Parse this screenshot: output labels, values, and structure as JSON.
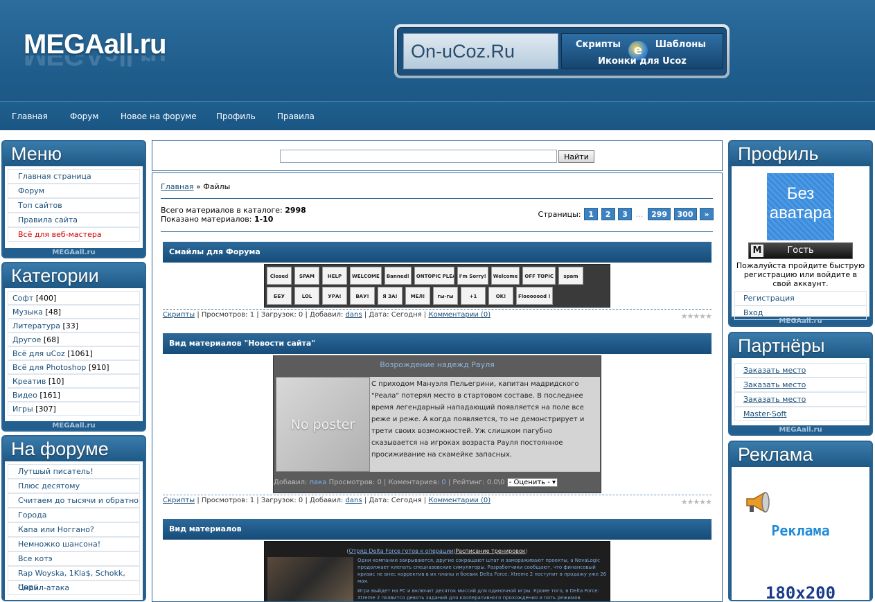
{
  "header": {
    "logo": "MEGAall.ru",
    "banner": {
      "brand": "On-uCoz.Ru",
      "link1": "Скрипты",
      "link2": "Шаблоны",
      "link3": "Иконки для Ucoz"
    }
  },
  "nav": [
    "Главная",
    "Форум",
    "Новое на форуме",
    "Профиль",
    "Правила"
  ],
  "menu": {
    "title": "Меню",
    "items": [
      "Главная страница",
      "Форум",
      "Топ сайтов",
      "Правила сайта",
      "Всё для веб-мастера"
    ],
    "footer": "MEGAall.ru"
  },
  "categories": {
    "title": "Категории",
    "items": [
      {
        "name": "Софт",
        "count": "[400]"
      },
      {
        "name": "Музыка",
        "count": "[48]"
      },
      {
        "name": "Литература",
        "count": "[33]"
      },
      {
        "name": "Другое",
        "count": "[68]"
      },
      {
        "name": "Всё для uCoz",
        "count": "[1061]"
      },
      {
        "name": "Всё для Photoshop",
        "count": "[910]"
      },
      {
        "name": "Креатив",
        "count": "[10]"
      },
      {
        "name": "Видео",
        "count": "[161]"
      },
      {
        "name": "Игры",
        "count": "[307]"
      }
    ],
    "footer": "MEGAall.ru"
  },
  "forum": {
    "title": "На форуме",
    "items": [
      "Лутшый писатель!",
      "Плюс десятому",
      "Считаем до тысячи и обратно",
      "Города",
      "Капа или Ноггано?",
      "Немножко шансона!",
      "Все котэ",
      "Rap Woyska, 1Kla$, Schokk, Царь.",
      "Смайл-атака"
    ]
  },
  "search": {
    "button": "Найти"
  },
  "content": {
    "breadcrumb_home": "Главная",
    "breadcrumb_sep": " » ",
    "breadcrumb_current": "Файлы",
    "total_label": "Всего материалов в каталоге: ",
    "total_value": "2998",
    "shown_label": "Показано материалов: ",
    "shown_value": "1-10",
    "pages_label": "Страницы:",
    "pages": [
      "1",
      "2",
      "3",
      "…",
      "299",
      "300",
      "»"
    ],
    "entries": [
      {
        "title": "Смайлы для Форума",
        "category": "Скрипты",
        "views": " | Просмотров: 1 | Загрузок: 0 | Добавил: ",
        "author": "dans",
        "date": " | Дата: Сегодня | ",
        "comments": "Комментарии (0)"
      },
      {
        "title": "Вид материалов \"Новости сайта\"",
        "category": "Скрипты",
        "views": " | Просмотров: 1 | Загрузок: 0 | Добавил: ",
        "author": "dans",
        "date": " | Дата: Сегодня | ",
        "comments": "Комментарии (0)"
      },
      {
        "title": "Вид материалов"
      }
    ],
    "news_preview": {
      "heading": "Возрождение надежд Рауля",
      "poster": "No poster",
      "text": "С приходом Мануэля Пельегрини, капитан мадридского \"Реала\" потерял место в стартовом составе. В последнее время легендарный нападающий появляется на поле все реже и реже. А когда появляется, то не демонстрирует и трети своих возможностей. Уж слишком пагубно сказывается на игроках возраста Рауля постоянное просиживание на скамейке запасных.",
      "footer_added": "Добавил: ",
      "footer_author": "пака",
      "footer_rest": " Просмотров: 0 | Коментариев: ",
      "footer_comments": "0",
      "footer_rating": " | Рейтинг: 0.0\\0",
      "rate_option": "- Оценить -"
    },
    "game_preview": {
      "link1": "Отряд Delta Force готов к операции",
      "link2": "Расписание тренировок",
      "text1": "Одни компании закрываются, другие сокращают штат и замораживают проекты, а NovaLogic продолжает клепать спецназовские симуляторы. Разработчики сообщают, что финансовый кризис не внес корректив в их планы и боевик Delta Force: Xtreme 2 поступит в продажу уже 26 мая.",
      "text2": "Игра выйдет на PC и включит десяток миссий для одиночной игры. Кроме того, в Delta Force: Xtreme 2 появится девять заданий для кооперативного прохождения и пять режимов"
    },
    "smileys": [
      "Closed",
      "SPAM",
      "HELP",
      "WELCOME",
      "Banned!",
      "ONTOPIC PLEASE",
      "I'm Sorry!",
      "Welcome",
      "OFF TOPIC",
      "spam",
      "ББУ",
      "LOL",
      "УРА!",
      "ВАУ!",
      "Я ЗА!",
      "МЕЛ!",
      "гы-гы",
      "+1",
      "OK!",
      "Flooooood !"
    ]
  },
  "profile": {
    "title": "Профиль",
    "avatar": "Без аватара",
    "user": "Гость",
    "text": "Пожалуйста пройдите быструю регистрацию или войдите в свой аккаунт.",
    "links": [
      "Регистрация",
      "Вход"
    ],
    "footer": "MEGAall.ru"
  },
  "partners": {
    "title": "Партнёры",
    "items": [
      "Заказать место",
      "Заказать место",
      "Заказать место",
      "Master-Soft"
    ],
    "footer": "MEGAall.ru"
  },
  "ads": {
    "title": "Реклама",
    "text": "Реклама",
    "size": "180x200"
  }
}
